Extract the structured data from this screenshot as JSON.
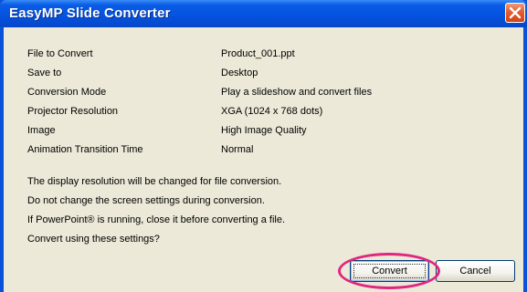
{
  "window": {
    "title": "EasyMP Slide Converter",
    "close_icon": "close-icon"
  },
  "info": [
    {
      "label": "File to Convert",
      "value": "Product_001.ppt"
    },
    {
      "label": "Save to",
      "value": "Desktop"
    },
    {
      "label": "Conversion Mode",
      "value": "Play a slideshow and convert files"
    },
    {
      "label": "Projector Resolution",
      "value": "XGA (1024 x 768 dots)"
    },
    {
      "label": "Image",
      "value": "High Image Quality"
    },
    {
      "label": "Animation Transition Time",
      "value": "Normal"
    }
  ],
  "messages": [
    "The display resolution will be changed for file conversion.",
    "Do not change the screen settings during conversion.",
    "If PowerPoint® is running, close it before converting a file.",
    "Convert using these settings?"
  ],
  "buttons": {
    "convert_label": "Convert",
    "cancel_label": "Cancel"
  },
  "colors": {
    "titlebar": "#0553e0",
    "client_bg": "#ece9d8",
    "highlight": "#e0267f",
    "close_button": "#e35d2f"
  }
}
